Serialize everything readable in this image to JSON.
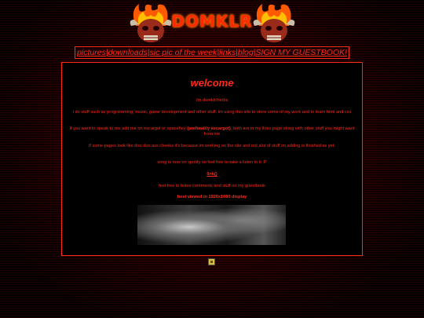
{
  "logo": {
    "text": "DOMKLR"
  },
  "nav": {
    "items": [
      {
        "label": "pictures"
      },
      {
        "label": "downloads"
      },
      {
        "label": "sic pic of the week"
      },
      {
        "label": "links"
      },
      {
        "label": "blog"
      },
      {
        "label": "SIGN MY GUESTBOOK!"
      }
    ],
    "separator": "|"
  },
  "main": {
    "title": "welcome",
    "paragraphs": {
      "intro": "i'm domklr/herbs",
      "about": "i do stuff such as programming, music, game development and other stuff. im using this site to store some of my work and to learn html and css",
      "contact_pre": "if you want to speak to me add me on escargot or spacehey ",
      "contact_em": "(preferably escargot)",
      "contact_post": ", both are in my links page along with other stuff you might want from me",
      "cheeks": "if some pages look like doo doo ass cheeks it's because im working on the site and not alot of stuff im adding is finished as yet.",
      "song": "song is now on spotify so feel free to take a listen to it :P",
      "song_link": "link()",
      "guestbook": "feel free to leave comments and stuff on my guestbook",
      "best_viewed": "best viewed in 1920x1080 display"
    }
  },
  "colors": {
    "accent": "#ff2a1a",
    "background": "#000000"
  },
  "icons": [
    "demon-skull-icon",
    "badge-icon"
  ]
}
